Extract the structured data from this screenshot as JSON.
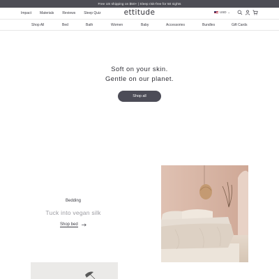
{
  "promo": {
    "text": "Free US shipping on $50+ | Sleep risk-free for 50 nights"
  },
  "header": {
    "nav": [
      "Impact",
      "Materials",
      "Reviews",
      "Sleep Quiz"
    ],
    "logo": "ettitude",
    "currency": "USD",
    "icons": [
      "search-icon",
      "account-icon",
      "cart-icon"
    ]
  },
  "categories": [
    "Shop All",
    "Bed",
    "Bath",
    "Women",
    "Baby",
    "Accessories",
    "Bundles",
    "Gift Cards"
  ],
  "hero": {
    "line1": "Soft on your skin.",
    "line2": "Gentle on our planet.",
    "button": "Shop all"
  },
  "bedding": {
    "eyebrow": "Bedding",
    "headline": "Tuck into vegan silk",
    "link": "Shop bed"
  },
  "colors": {
    "promo_bg": "#4d4d55",
    "button_bg": "#4c4c57",
    "text": "#3c3c44",
    "muted": "#9c9ca2",
    "bedroom_wall": "#d9b7a6",
    "linen": "#e6ddd3"
  }
}
